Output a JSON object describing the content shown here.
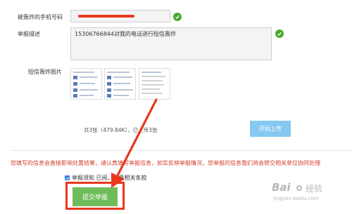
{
  "form": {
    "phone_label": "被轰炸的手机号码",
    "phone_value": "",
    "desc_label": "举报描述",
    "desc_value": "15306766844对我的电话进行短信轰炸",
    "images_label": "短信轰炸图片",
    "thumbnail_count": 3,
    "upload_status": "共3张（479.84K），已上传3张",
    "upload_button": "开始上传",
    "notice": "您填写的信息会直接影响处置结果，请认真填写举报信息，如实反映举报情况，您举报的信息我们将会转交相关单位协同处理",
    "agree_checked": true,
    "agree_text": "举报须知 已阅，同意相关条款",
    "submit_button": "提交举报"
  },
  "annotation": {
    "color": "#e8381e"
  },
  "watermark": {
    "brand": "Bai",
    "brand_suffix": "经验",
    "url": "jingyan.baidu.com"
  },
  "colors": {
    "success": "#46a92c",
    "upload_button": "#87c8f2",
    "submit_button": "#6fbd5a",
    "notice_text": "#d33b2a",
    "checkbox": "#3b7de0"
  }
}
